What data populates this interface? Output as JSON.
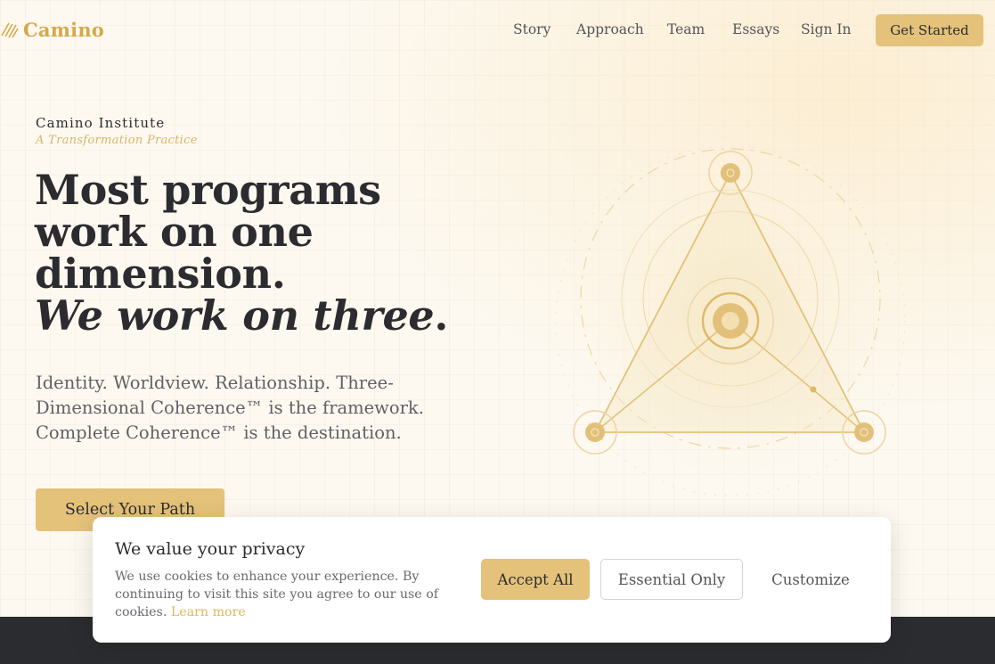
{
  "brand": {
    "name": "Camino",
    "accent": "#e4c27a",
    "logo_color": "#d4a94a"
  },
  "nav": {
    "items": [
      {
        "label": "Story"
      },
      {
        "label": "Approach"
      },
      {
        "label": "Team"
      },
      {
        "label": "Essays"
      },
      {
        "label": "Sign In"
      }
    ],
    "cta_label": "Get Started"
  },
  "hero": {
    "eyebrow": "Camino Institute",
    "tagline": "A Transformation Practice",
    "headline_lines": [
      "Most programs",
      "work on one",
      "dimension."
    ],
    "headline_italic": "We work on three",
    "headline_period": ".",
    "subtext": "Identity. Worldview. Relationship. Three-Dimensional Coherence™ is the framework. Complete Coherence™ is the destination.",
    "cta_label": "Select Your Path"
  },
  "diagram": {
    "icon": "three-dimensional-triangle-icon"
  },
  "cookie": {
    "title": "We value your privacy",
    "text": "We use cookies to enhance your experience. By continuing to visit this site you agree to our use of cookies.",
    "link": "Learn more",
    "accept_label": "Accept All",
    "essential_label": "Essential Only",
    "customize_label": "Customize"
  }
}
